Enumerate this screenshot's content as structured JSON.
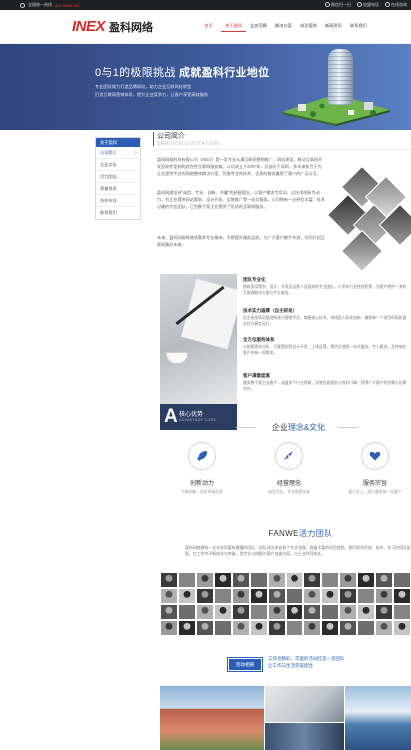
{
  "topbar": {
    "phone_label": "全国统一热线",
    "phone": "400-8888-116",
    "links": [
      "微信扫一扫",
      "加盟电话",
      "在线咨询"
    ]
  },
  "header": {
    "logo_en": "INEX",
    "logo_cn": "盈科网络",
    "nav": [
      {
        "label": "首页",
        "style": "red"
      },
      {
        "label": "关于盈科",
        "style": "active"
      },
      {
        "label": "业务范畴",
        "style": "normal"
      },
      {
        "label": "解决方案",
        "style": "normal"
      },
      {
        "label": "成功案例",
        "style": "normal"
      },
      {
        "label": "新闻资讯",
        "style": "normal"
      },
      {
        "label": "联系我们",
        "style": "normal"
      }
    ]
  },
  "banner": {
    "title_a": "0与1的极限挑战",
    "title_b": "成就盈科行业地位",
    "lines": [
      "专业团队倾力打造品牌网站，助力企业互联网化转型",
      "打造互联网营销体系，提升企业竞争力，让客户享受高效服务"
    ]
  },
  "sidebar": {
    "head": "关于盈科",
    "items": [
      "公司简介",
      "企业文化",
      "活力团队",
      "荣誉资质",
      "合作伙伴",
      "联系我们"
    ]
  },
  "about": {
    "title": "公司简介",
    "subtitle": "SERVICE QUOTATION",
    "paragraphs": [
      "盈科网络科技有限公司（INEX）是一家专业从事互联网营销推广、网站建设、移动互联网开发及软件定制的综合性互联网服务商。公司成立于2007年，总部位于深圳，多年来致力于为企业提供专业的网络整体解决方案，凭借专业的技术、优质的服务赢得了客户的广泛认可。",
      "盈科网络坚持\"诚信、专业、创新、共赢\"的经营理念，以客户需求为导向，以技术创新为动力，为企业提供网站策划、设计开发、运营推广等一站式服务。公司拥有一支经验丰富、技术过硬的专业团队，已为数千家企业提供了优质的互联网服务。",
      "未来，盈科网络将继续秉承专业精神，不断提升服务品质，与广大客户携手共进，共同开创互联网美好未来。"
    ]
  },
  "advantage": {
    "letter": "A",
    "title": "核心优势",
    "subtitle": "ADVANTAGE CORE",
    "items": [
      {
        "title": "团队专业化",
        "text": "拥有资深策划、设计、开发及运营人员组成的专业团队，十余年行业经验积累，为客户提供一流的互联网解决方案与专业服务。"
      },
      {
        "title": "技术实力雄厚（自主研发）",
        "text": "自主研发网站管理系统与营销平台，掌握核心技术，持续投入研发创新，确保每一个项目的高质量交付与稳定运行。"
      },
      {
        "title": "全方位服务体系",
        "text": "从前期需求分析、方案策划到设计开发、上线运营，提供全流程一站式服务，专人跟进，及时响应客户的每一项需求。"
      },
      {
        "title": "客户满意度高",
        "text": "服务数千家企业客户，涵盖多个行业领域，凭借优质服务与良好口碑，获得广大客户的信赖与长期合作。"
      }
    ]
  },
  "culture": {
    "title_a": "企业",
    "title_b": "理念&文化",
    "items": [
      {
        "name": "创新动力",
        "desc": "不断创新，追求卓越品质"
      },
      {
        "name": "经营理念",
        "desc": "诚信为本，专业成就未来"
      },
      {
        "name": "服务宗旨",
        "desc": "客户至上，用心服务每一位客户"
      }
    ]
  },
  "team": {
    "title_a": "FANWE",
    "title_b": "活力团队",
    "desc": "盈科网络拥有一支年轻而富有激情的团队，团队成员来自各个专业领域，具备丰富的项目经验。我们崇尚开放、协作、学习的团队氛围，在工作中不断成长与突破，用专业与热情为客户创造价值，与企业共同成长。"
  },
  "photos": {
    "button": "活动相册",
    "title": "工作也精彩，丰富的活动打造一流团队",
    "title2": "让工作与生活完美结合"
  },
  "colors": {
    "accent_blue": "#2b5fb5",
    "brand_red": "#d82a24",
    "banner_navy": "#32457c",
    "advantage_navy": "#2c3d63"
  }
}
